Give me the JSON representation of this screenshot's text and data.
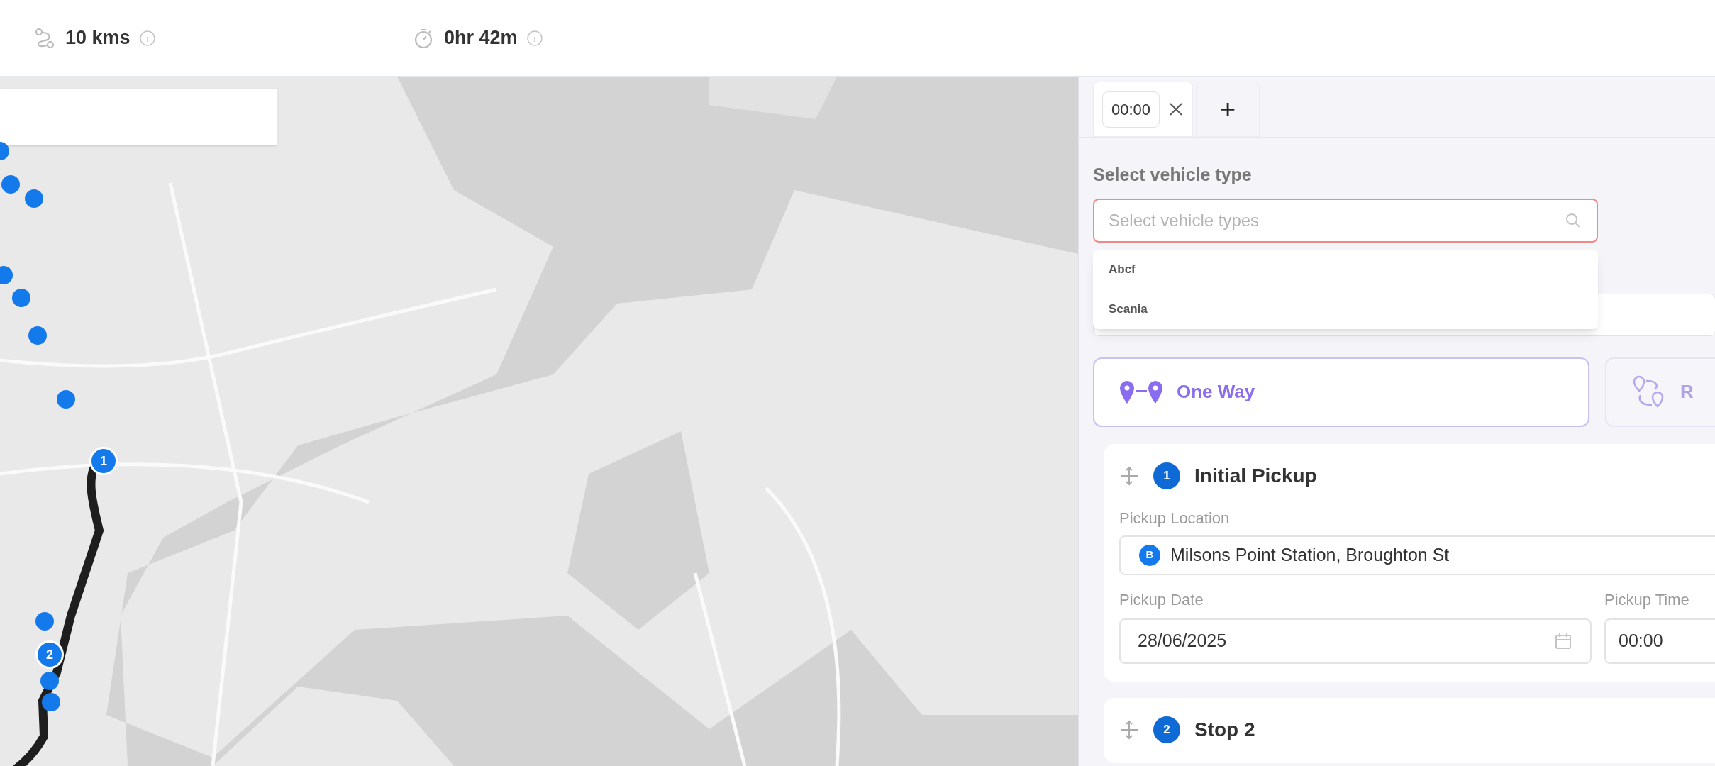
{
  "summary": [
    {
      "kind": "distance",
      "value": "10 kms"
    },
    {
      "kind": "duration",
      "value": "0hr 42m"
    }
  ],
  "map": {
    "pins": [
      "1",
      "2"
    ]
  },
  "tabs": [
    {
      "label": "00:00",
      "selected": true
    }
  ],
  "add_tab": "+",
  "vehicle_type": {
    "label": "Select vehicle type",
    "placeholder": "Select vehicle types",
    "error": true,
    "options": [
      "Abcf",
      "Scania"
    ]
  },
  "trip_modes": [
    {
      "kind": "one_way",
      "label": "One Way",
      "selected": true
    },
    {
      "kind": "round_trip",
      "label": "R",
      "selected": false
    }
  ],
  "stops": [
    {
      "number": "1",
      "title": "Initial Pickup",
      "location_label": "Pickup Location",
      "location_badge": "B",
      "location": "Milsons Point Station, Broughton St",
      "date_label": "Pickup Date",
      "date": "28/06/2025",
      "time_label": "Pickup Time",
      "time": "00:00"
    },
    {
      "number": "2",
      "title": "Stop 2"
    }
  ]
}
